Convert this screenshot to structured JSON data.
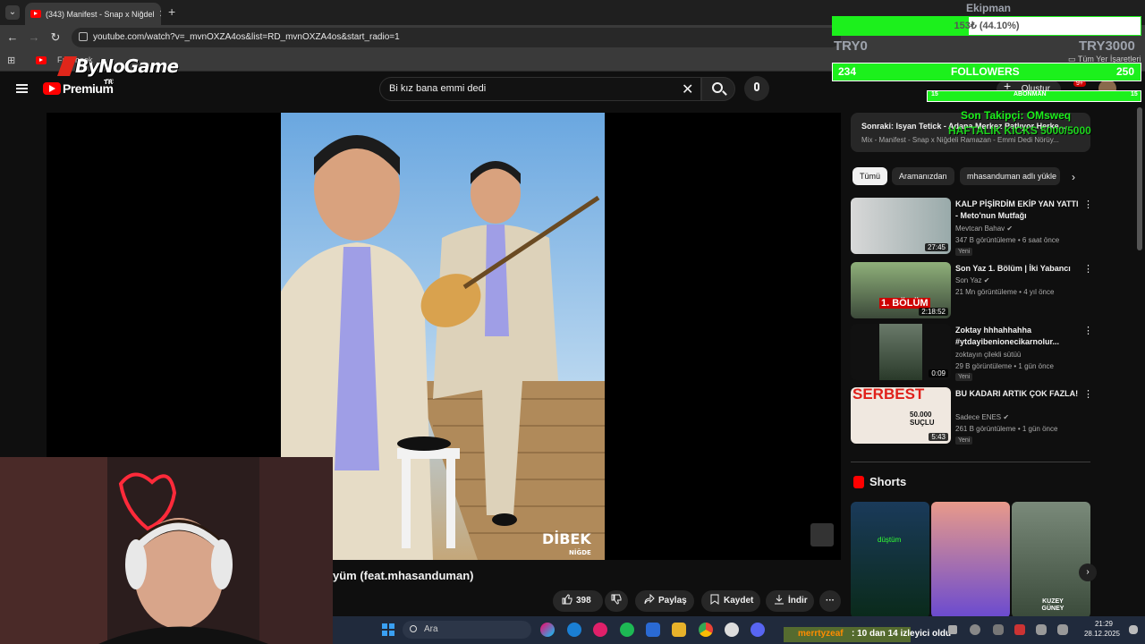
{
  "browser": {
    "tab_title": "(343) Manifest - Snap x Niğdel",
    "url": "youtube.com/watch?v=_mvnOXZA4os&list=RD_mvnOXZA4os&start_radio=1",
    "bookmark_fb": "Facebook",
    "bookmark_all": "Tüm Yer İşaretleri"
  },
  "overlay": {
    "brand": "ByNoGame",
    "brand_region": "TR",
    "goal_title": "Ekipman",
    "goal_text": "153₺ (44.10%)",
    "goal_progress": 0.441,
    "goal_min": "TRY0",
    "goal_max": "TRY3000",
    "followers_count": "234",
    "followers_label": "FOLLOWERS",
    "followers_max": "250",
    "sub_left": "15",
    "sub_label": "ABONMAN",
    "sub_right": "15",
    "last_follower": "Son Takipçi: OMsweq",
    "weekly_kicks": "HAFTALIK KICKS 5000/5000",
    "accent": "#1cf01c"
  },
  "youtube": {
    "premium": "Premium",
    "premium_region": "TR",
    "search_value": "Bi kız bana emmi dedi",
    "create_label": "Oluştur",
    "notif_count": "9+"
  },
  "video": {
    "title_visible": "yüm (feat.mhasanduman)",
    "likes": "398",
    "share": "Paylaş",
    "save": "Kaydet",
    "download": "İndir",
    "art_watermark": "DİBEK",
    "art_watermark_sub": "NİĞDE"
  },
  "sidebar": {
    "next_title": "Sonraki: Isyan Tetick - Adana Merkez Patlıyor Herke...",
    "next_sub": "Mix - Manifest - Snap x Niğdeli Ramazan - Emmi Dedi Nörüy...",
    "chips": [
      "Tümü",
      "Aramanızdan",
      "mhasanduman adlı yükle"
    ],
    "recs": [
      {
        "title": "KALP PİŞİRDİM EKİP YAN YATTI - Meto'nun Mutfağı",
        "channel": "Mevtcan Bahav",
        "views": "347 B görüntüleme",
        "age": "6 saat önce",
        "duration": "27:45",
        "new": "Yeni"
      },
      {
        "title": "Son Yaz 1. Bölüm | İki Yabancı",
        "channel": "Son Yaz",
        "views": "21 Mn görüntüleme",
        "age": "4 yıl önce",
        "duration": "2:18:52",
        "thumb_text": "1. BÖLÜM",
        "new": ""
      },
      {
        "title": "Zoktay hhhahhahha #ytdayibenionecikarnolur...",
        "channel": "zoktayın çilekli sütüü",
        "views": "29 B görüntüleme",
        "age": "1 gün önce",
        "duration": "0:09",
        "new": "Yeni"
      },
      {
        "title": "BU KADARI ARTIK ÇOK FAZLA!",
        "channel": "Sadece ENES",
        "views": "261 B görüntüleme",
        "age": "1 gün önce",
        "duration": "5:43",
        "thumb_text": "SERBEST",
        "thumb_text2": "50.000 SUÇLU",
        "new": "Yeni"
      }
    ],
    "shorts_label": "Shorts",
    "short_texts": [
      "düştüm",
      "",
      "KUZEY GÜNEY"
    ]
  },
  "taskbar": {
    "search_placeholder": "Ara",
    "chat_user": "merrtyzeaf",
    "chat_msg": ": 10 dan 14 izleyici oldu",
    "time": "21:29",
    "date": "28.12.2025"
  }
}
